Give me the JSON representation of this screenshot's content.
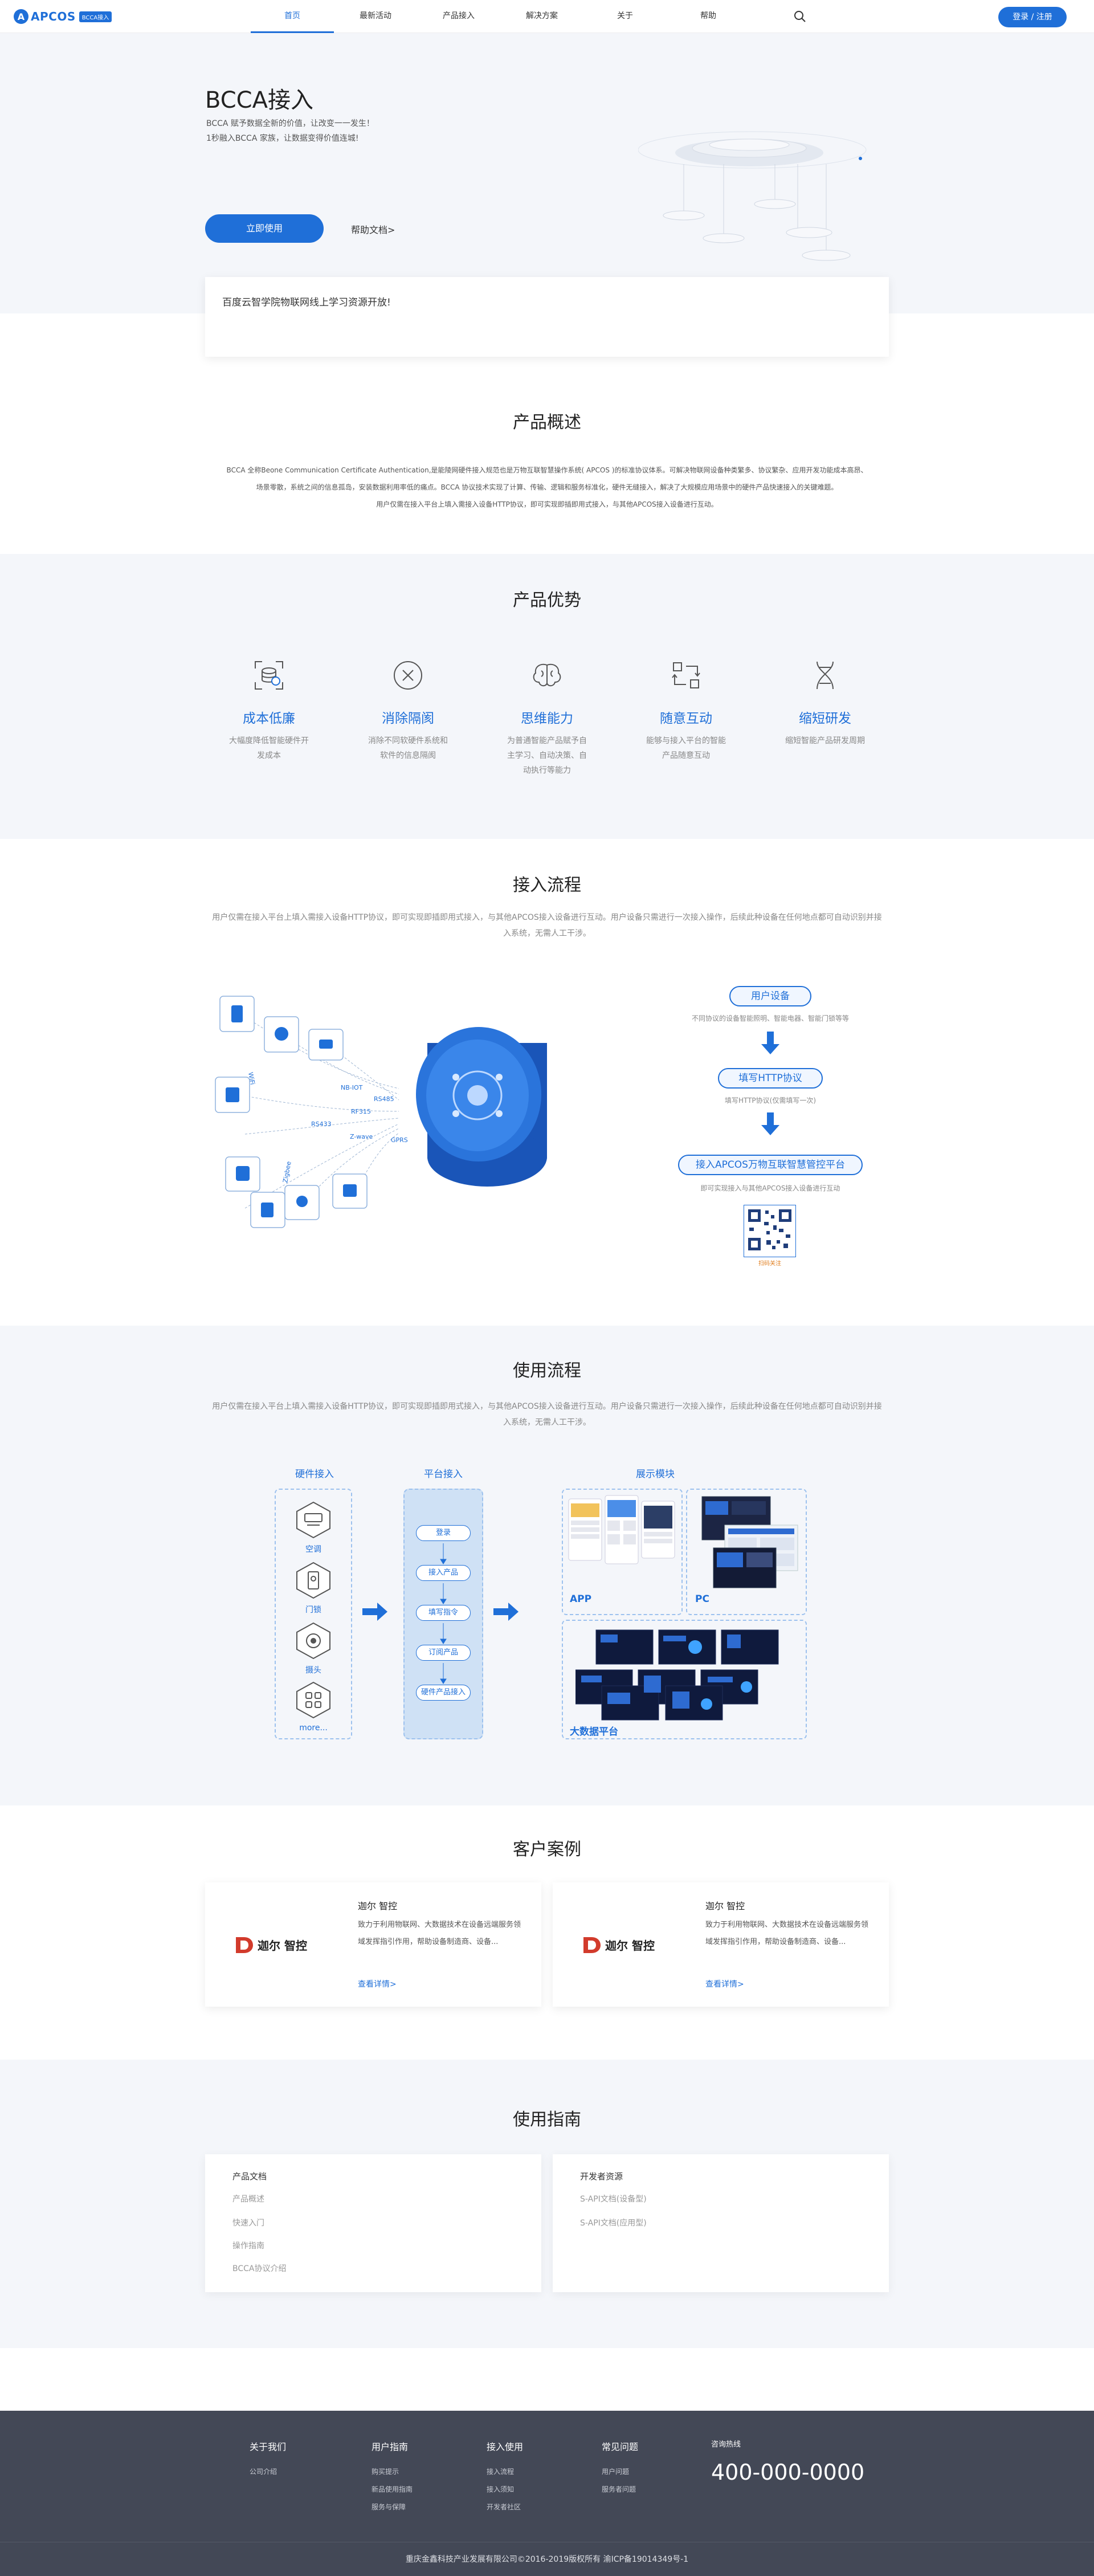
{
  "nav": {
    "logo_text": "APCOS",
    "logo_badge": "BCCA接入",
    "items": [
      "首页",
      "最新活动",
      "产品接入",
      "解决方案",
      "关于",
      "帮助"
    ],
    "login": "登录 / 注册"
  },
  "hero": {
    "title": "BCCA接入",
    "desc": "BCCA 赋予数据全新的价值，让改变一一发生！\n1秒融入BCCA 家族，让数据变得价值连城!",
    "cta": "立即使用",
    "help_link": "帮助文档>",
    "notice": "百度云智学院物联网线上学习资源开放!"
  },
  "overview": {
    "title": "产品概述",
    "lines": [
      "BCCA 全称Beone Communication Certificate Authentication,是能陵网硬件接入规范也是万物互联智慧操作系统( APCOS )的标准协议体系。可解决物联网设备种类繁多、协议繁杂、应用开发功能成本高昂、",
      "场景零散，系统之间的信息孤岛，安装数据利用率低的痛点。BCCA 协议技术实现了计算、传输、逻辑和服务标准化，硬件无缝接入，解决了大规模应用场景中的硬件产品快速接入的关键难题。",
      "用户仅需在接入平台上填入需接入设备HTTP协议，即可实现即插即用式接入，与其他APCOS接入设备进行互动。"
    ]
  },
  "advantages": {
    "title": "产品优势",
    "items": [
      {
        "icon": "cost-icon",
        "title": "成本低廉",
        "desc": "大幅度降低智能硬件开发成本"
      },
      {
        "icon": "barrier-icon",
        "title": "消除隔阂",
        "desc": "消除不同软硬件系统和软件的信息隔阂"
      },
      {
        "icon": "brain-icon",
        "title": "思维能力",
        "desc": "为普通智能产品赋予自主学习、自动决策、自动执行等能力"
      },
      {
        "icon": "interaction-icon",
        "title": "随意互动",
        "desc": "能够与接入平台的智能产品随意互动"
      },
      {
        "icon": "dna-icon",
        "title": "缩短研发",
        "desc": "缩短智能产品研发周期"
      }
    ]
  },
  "access_flow": {
    "title": "接入流程",
    "desc": "用户仅需在接入平台上填入需接入设备HTTP协议，即可实现即插即用式接入，与其他APCOS接入设备进行互动。用户设备只需进行一次接入操作，后续此种设备在任何地点都可自动识别并接入系统，无需人工干涉。",
    "protocols": [
      "NB-IOT",
      "RS485",
      "RF315",
      "RS433",
      "Z-wave",
      "GPRS",
      "Zigbee",
      "WiFi"
    ],
    "steps": [
      {
        "label": "用户设备",
        "sub": "不同协议的设备智能照明、智能电器、智能门锁等等"
      },
      {
        "label": "填写HTTP协议",
        "sub": "填写HTTP协议(仅需填写一次)"
      },
      {
        "label": "接入APCOS万物互联智慧管控平台",
        "sub": "即可实现接入与其他APCOS接入设备进行互动"
      }
    ],
    "qr_caption": "扫码关注"
  },
  "usage_flow": {
    "title": "使用流程",
    "desc": "用户仅需在接入平台上填入需接入设备HTTP协议，即可实现即插即用式接入，与其他APCOS接入设备进行互动。用户设备只需进行一次接入操作，后续此种设备在任何地点都可自动识别并接入系统，无需人工干涉。",
    "col_hardware": "硬件接入",
    "col_platform": "平台接入",
    "col_display": "展示模块",
    "hardware": [
      "空调",
      "门锁",
      "摄头",
      "more..."
    ],
    "platform_steps": [
      "登录",
      "接入产品",
      "填写指令",
      "订阅产品",
      "硬件产品接入"
    ],
    "display": [
      "APP",
      "PC",
      "大数据平台"
    ]
  },
  "cases": {
    "title": "客户案例",
    "items": [
      {
        "logo": "迦尔 智控",
        "name": "迦尔 智控",
        "text": "致力于利用物联网、大数据技术在设备远端服务领域发挥指引作用，帮助设备制造商、设备...",
        "link": "查看详情>"
      },
      {
        "logo": "迦尔 智控",
        "name": "迦尔 智控",
        "text": "致力于利用物联网、大数据技术在设备远端服务领域发挥指引作用，帮助设备制造商、设备...",
        "link": "查看详情>"
      }
    ]
  },
  "guide": {
    "title": "使用指南",
    "left": {
      "head": "产品文档",
      "items": [
        "产品概述",
        "快速入门",
        "操作指南",
        "BCCA协议介绍"
      ]
    },
    "right": {
      "head": "开发者资源",
      "items": [
        "S-API文档(设备型)",
        "S-API文档(应用型)"
      ]
    }
  },
  "footer": {
    "cols": [
      {
        "head": "关于我们",
        "items": [
          "公司介绍"
        ]
      },
      {
        "head": "用户指南",
        "items": [
          "购买提示",
          "新品使用指南",
          "服务与保障"
        ]
      },
      {
        "head": "接入使用",
        "items": [
          "接入流程",
          "接入须知",
          "开发者社区"
        ]
      },
      {
        "head": "常见问题",
        "items": [
          "用户问题",
          "服务者问题"
        ]
      }
    ],
    "phone_label": "咨询热线",
    "phone": "400-000-0000",
    "copyright": "重庆金鑫科技产业发展有限公司©2016-2019版权所有  渝ICP备19014349号-1"
  },
  "colors": {
    "accent": "#1f6fd8",
    "bg_light": "#f4f6fa",
    "footer_bg": "#434856"
  }
}
